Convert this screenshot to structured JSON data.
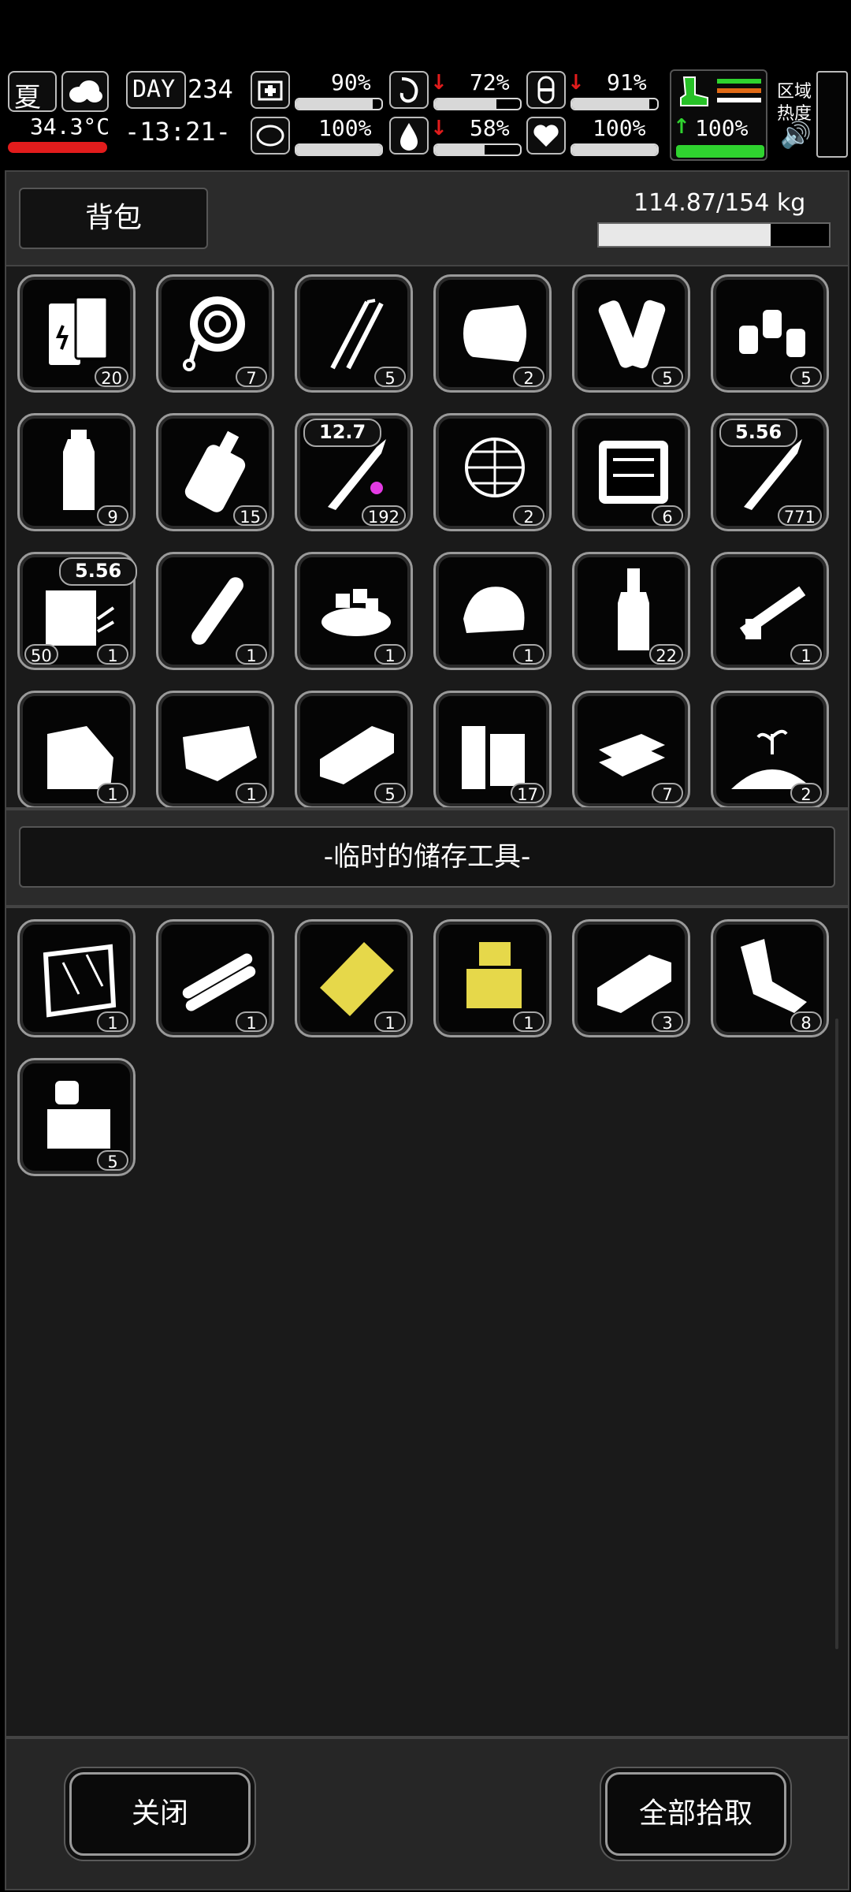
{
  "hud": {
    "season": "夏",
    "temperature": "34.3°C",
    "day_label": "DAY",
    "day_number": "234",
    "time": "-13:21-",
    "health_pct": "90%",
    "health_fill": 0.9,
    "hunger_pct": "72%",
    "hunger_fill": 0.72,
    "sleep_pct": "91%",
    "sleep_fill": 0.91,
    "stamina_pct": "100%",
    "stamina_fill": 1.0,
    "thirst_pct": "58%",
    "thirst_fill": 0.58,
    "mood_pct": "100%",
    "mood_fill": 1.0,
    "speed_pct": "100%",
    "speed_fill": 1.0,
    "area_heat_label_1": "区域",
    "area_heat_label_2": "热度"
  },
  "backpack": {
    "title": "背包",
    "weight": "114.87/154 kg",
    "weight_fill": 0.746,
    "items": [
      {
        "icon": "battery-icon",
        "qty": "20"
      },
      {
        "icon": "rope-icon",
        "qty": "7"
      },
      {
        "icon": "lockpick-icon",
        "qty": "5"
      },
      {
        "icon": "cloth-roll-icon",
        "qty": "2"
      },
      {
        "icon": "bandage-icon",
        "qty": "5"
      },
      {
        "icon": "gas-canister-icon",
        "qty": "5"
      },
      {
        "icon": "water-bottle-icon",
        "qty": "9"
      },
      {
        "icon": "blood-bag-icon",
        "qty": "15"
      },
      {
        "icon": "bullet-12-7-icon",
        "qty": "192",
        "caliber": "12.7"
      },
      {
        "icon": "net-trap-icon",
        "qty": "2"
      },
      {
        "icon": "toolbox-icon",
        "qty": "6"
      },
      {
        "icon": "bullet-5-56-icon",
        "qty": "771",
        "caliber": "5.56"
      },
      {
        "icon": "ammo-box-icon",
        "qty": "1",
        "caliber": "5.56",
        "extra": "50"
      },
      {
        "icon": "rolled-paper-icon",
        "qty": "1"
      },
      {
        "icon": "food-bowl-icon",
        "qty": "1"
      },
      {
        "icon": "meat-icon",
        "qty": "1"
      },
      {
        "icon": "liquor-bottle-icon",
        "qty": "22"
      },
      {
        "icon": "gun-part-icon",
        "qty": "1"
      },
      {
        "icon": "leather-icon",
        "qty": "1"
      },
      {
        "icon": "raw-meat-icon",
        "qty": "1"
      },
      {
        "icon": "metal-plate-icon",
        "qty": "5"
      },
      {
        "icon": "wood-planks-icon",
        "qty": "17"
      },
      {
        "icon": "stone-slabs-icon",
        "qty": "7"
      },
      {
        "icon": "soil-sprout-icon",
        "qty": "2"
      }
    ]
  },
  "storage": {
    "title": "-临时的储存工具-",
    "items": [
      {
        "icon": "glass-sheet-icon",
        "qty": "1"
      },
      {
        "icon": "pipes-icon",
        "qty": "1"
      },
      {
        "icon": "gold-plate-icon",
        "qty": "1",
        "color": "#e6d84a"
      },
      {
        "icon": "gold-parts-icon",
        "qty": "1",
        "color": "#e6d84a"
      },
      {
        "icon": "steel-bar-icon",
        "qty": "3"
      },
      {
        "icon": "scrap-metal-icon",
        "qty": "8"
      },
      {
        "icon": "electronic-parts-icon",
        "qty": "5"
      }
    ]
  },
  "buttons": {
    "close": "关闭",
    "pickup_all": "全部拾取"
  }
}
